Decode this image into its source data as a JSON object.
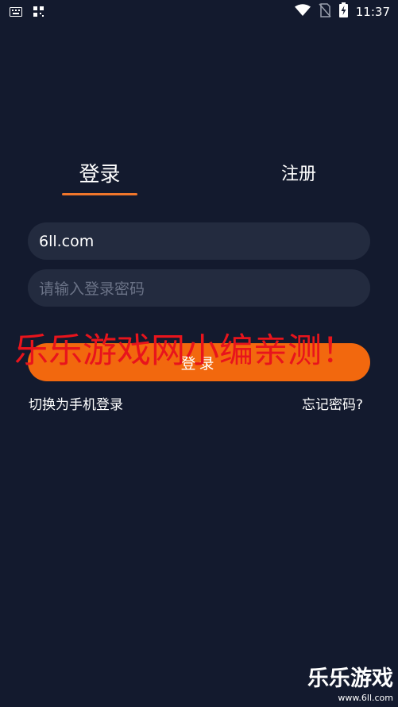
{
  "status_bar": {
    "time": "11:37",
    "icons": [
      "keyboard-icon",
      "grid-icon",
      "wifi-icon",
      "no-sim-icon",
      "battery-charging-icon"
    ]
  },
  "tabs": {
    "login": "登录",
    "register": "注册",
    "active": "login",
    "accent_color": "#f0762b"
  },
  "form": {
    "username_value": "6ll.com",
    "password_placeholder": "请输入登录密码",
    "submit_label": "登录",
    "button_color": "#f2680e"
  },
  "links": {
    "switch_to_phone": "切换为手机登录",
    "forgot_password": "忘记密码?"
  },
  "watermarks": {
    "overlay_text": "乐乐游戏网小编亲测！",
    "corner_title": "乐乐游戏",
    "corner_url": "www.6ll.com"
  },
  "colors": {
    "background": "#131a2e",
    "field_background": "#232b3f",
    "placeholder": "#6b7387",
    "watermark_red": "#e8141c"
  }
}
